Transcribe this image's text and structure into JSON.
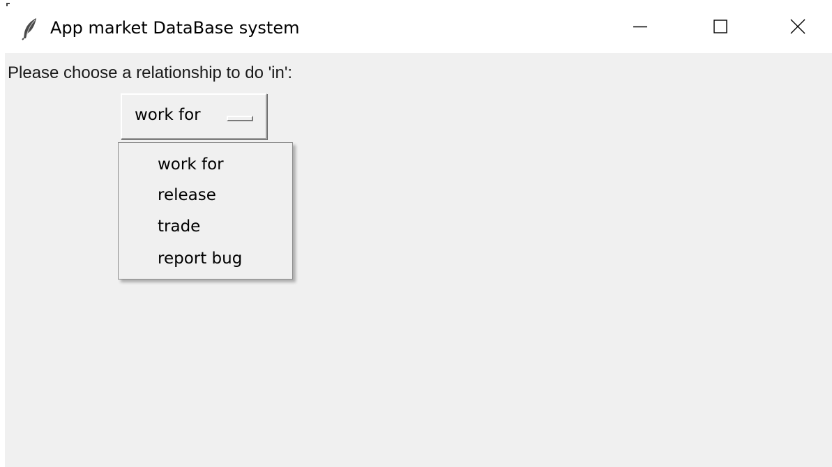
{
  "window": {
    "title": "App market DataBase system",
    "icon": "feather-icon",
    "controls": {
      "minimize": "minimize-icon",
      "maximize": "maximize-icon",
      "close": "close-icon"
    }
  },
  "main": {
    "prompt": "Please choose a relationship to do 'in':",
    "option_menu": {
      "selected": "work for",
      "options": [
        "work for",
        "release",
        "trade",
        "report bug"
      ],
      "expanded": true
    }
  },
  "colors": {
    "client_background": "#f0f0f0",
    "titlebar_background": "#ffffff",
    "text": "#000000"
  }
}
